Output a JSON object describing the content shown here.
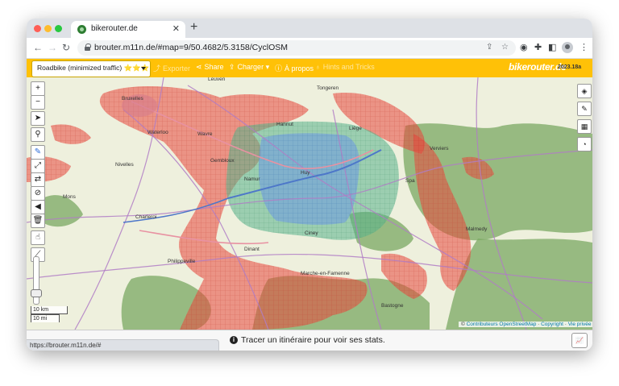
{
  "browser": {
    "tab_title": "bikerouter.de",
    "url": "brouter.m11n.de/#map=9/50.4682/5.3158/CyclOSM",
    "status_url": "https://brouter.m11n.de/#"
  },
  "app": {
    "profile_label": "Roadbike (minimized traffic) ⭐⭐⭐",
    "menu": {
      "export": "Exporter",
      "share": "Share",
      "load": "Charger",
      "about": "À propos",
      "hints": "Hints and Tricks"
    },
    "brand_name": "bikerouter.de",
    "version": "2023.18a"
  },
  "map": {
    "place_labels": [
      "Bruxelles",
      "Leuven",
      "Liège",
      "Namur",
      "Charleroi",
      "Mons",
      "Wavre",
      "Marche-en-Famenne",
      "Huy",
      "Philippeville",
      "Dinant",
      "Spa",
      "Verviers",
      "Nivelles",
      "Waterloo",
      "Ciney",
      "Malmedy",
      "Gembloux",
      "Hannut",
      "Tongeren",
      "Bastogne"
    ],
    "scale": {
      "km": "10 km",
      "mi": "10 mi"
    },
    "attribution_prefix": "©",
    "attribution_contributors": "Contributeurs OpenStreetMap",
    "attribution_copyright": "Copyright",
    "attribution_privacy": "Vie privée",
    "colors": {
      "coverage_red": "#e8473c",
      "area_blue": "#6f9fe0",
      "area_green": "#58b38a",
      "forest": "#7aa862",
      "land": "#eef0dd"
    }
  },
  "stats": {
    "message": "Tracer un itinéraire pour voir ses stats."
  },
  "icons": [
    "layers-icon",
    "wrench-icon",
    "table-icon",
    "pie-chart-icon",
    "zoom-in-icon",
    "zoom-out-icon",
    "locate-icon",
    "search-icon",
    "draw-icon",
    "route-icon",
    "reverse-icon",
    "no-go-icon",
    "beeline-icon",
    "trash-icon",
    "pois-icon",
    "elevation-icon"
  ]
}
